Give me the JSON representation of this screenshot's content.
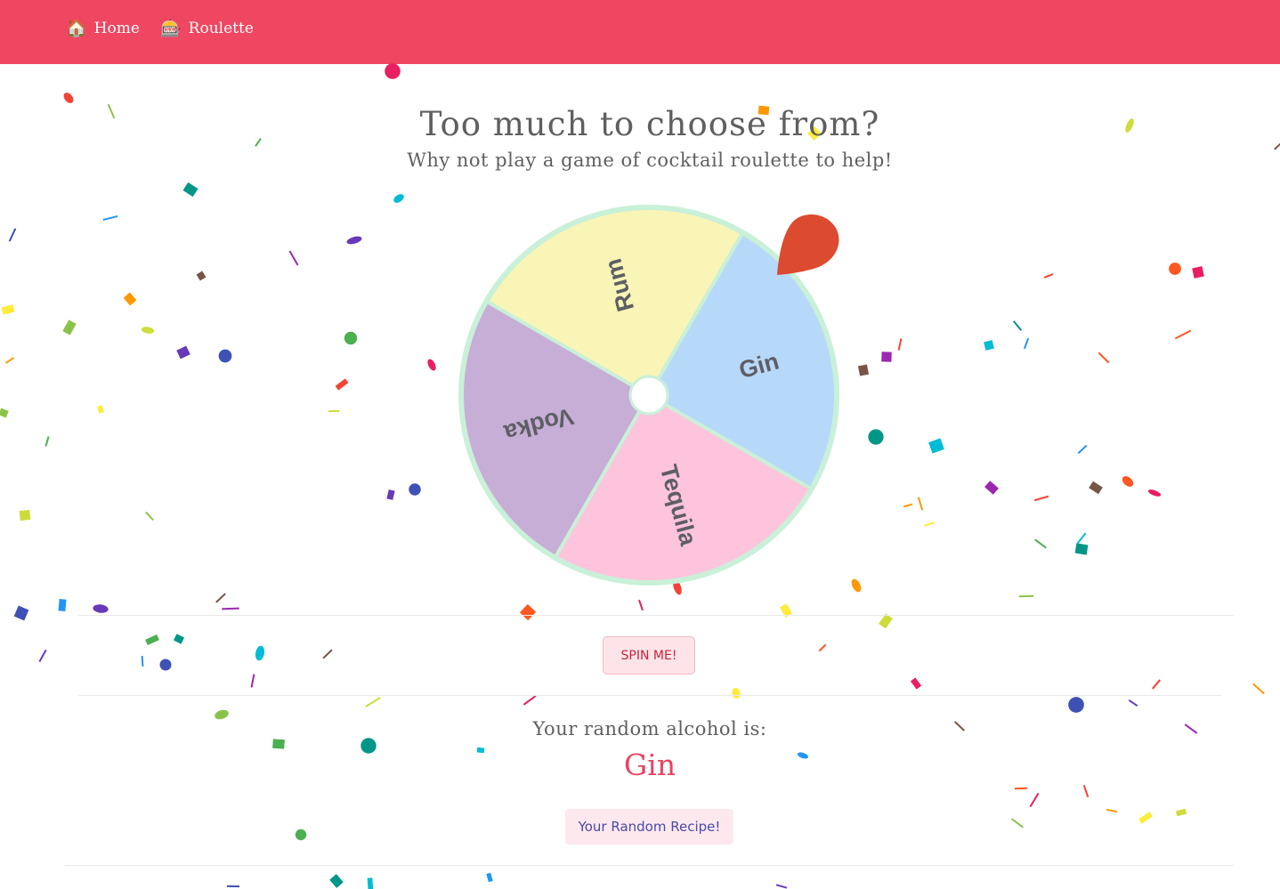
{
  "navbar": {
    "background": "#ef4661",
    "items": [
      {
        "label": "Home",
        "icon": "house-icon",
        "glyph": "🏠"
      },
      {
        "label": "Roulette",
        "icon": "slot-machine-icon",
        "glyph": "🎰"
      }
    ]
  },
  "main": {
    "headline": "Too much to choose from?",
    "subheadline": "Why not play a game of cocktail roulette to help!"
  },
  "wheel": {
    "border_color": "#c9f0d8",
    "pointer_color": "#dc4a2f",
    "segments": [
      {
        "label": "Rum",
        "color": "#f8f5b6"
      },
      {
        "label": "Gin",
        "color": "#b7d9f9"
      },
      {
        "label": "Tequila",
        "color": "#fec4dc"
      },
      {
        "label": "Vodka",
        "color": "#c7aed6"
      }
    ]
  },
  "spin_button": {
    "label": "SPIN ME!"
  },
  "result": {
    "label": "Your random alcohol is:",
    "value": "Gin"
  },
  "recipe_button": {
    "label": "Your Random Recipe!"
  },
  "confetti": {
    "colors": [
      "#e91e63",
      "#f44336",
      "#ff9800",
      "#ffeb3b",
      "#cddc39",
      "#8bc34a",
      "#4caf50",
      "#009688",
      "#00bcd4",
      "#2196f3",
      "#3f51b5",
      "#673ab7",
      "#9c27b0",
      "#795548",
      "#ff5722"
    ]
  }
}
